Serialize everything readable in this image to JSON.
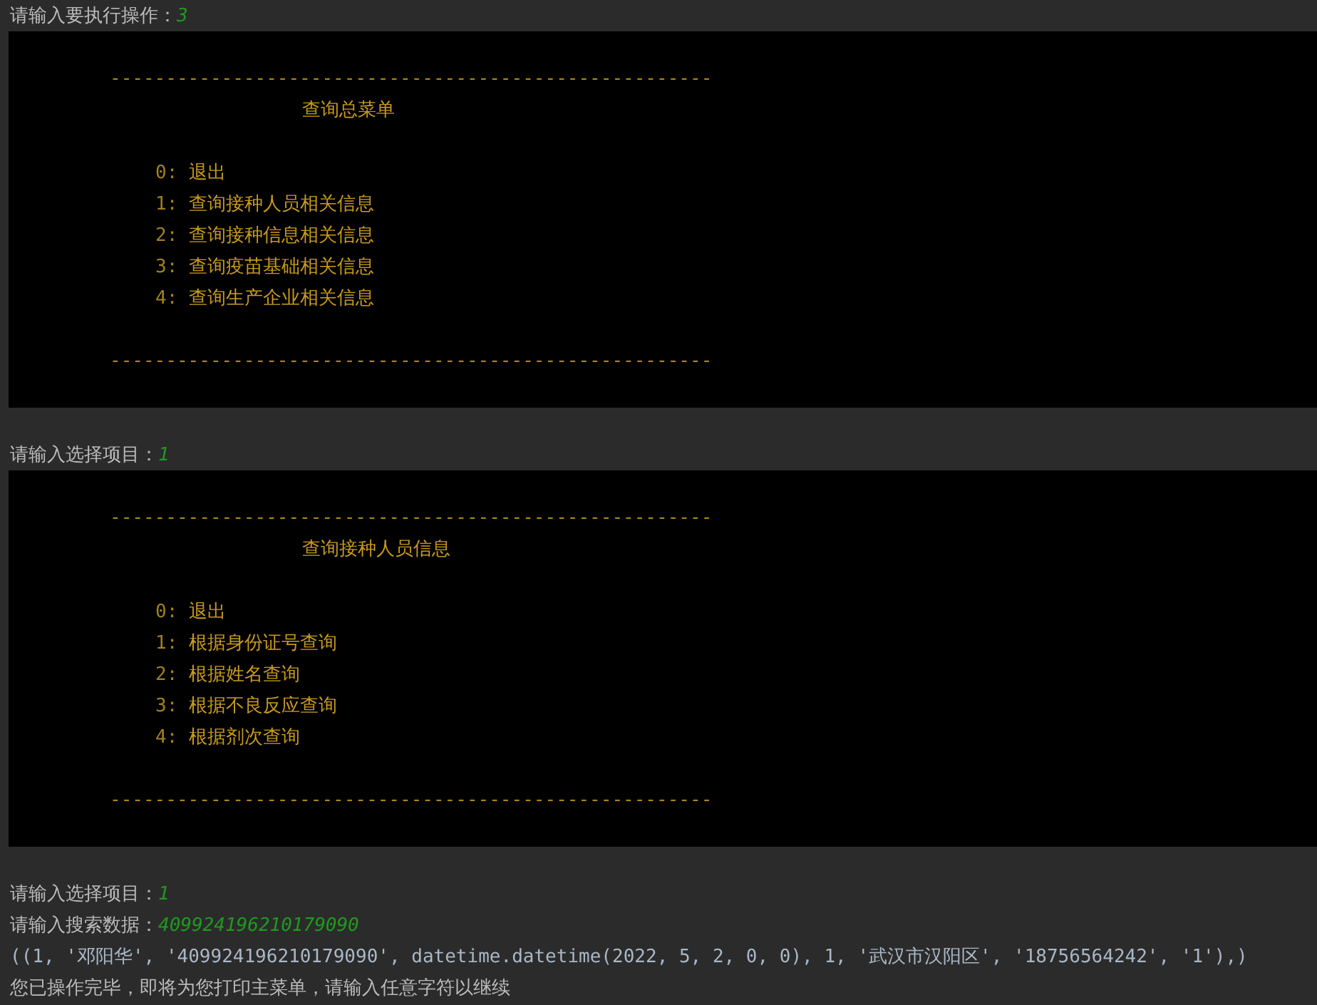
{
  "console": [
    {
      "kind": "prompt",
      "label": "请输入要执行操作：",
      "value": "3"
    },
    {
      "kind": "menu",
      "rule_top": "------------------------------------------------------",
      "title": "查询总菜单",
      "items": [
        {
          "key": "0:",
          "label": "退出"
        },
        {
          "key": "1:",
          "label": "查询接种人员相关信息"
        },
        {
          "key": "2:",
          "label": "查询接种信息相关信息"
        },
        {
          "key": "3:",
          "label": "查询疫苗基础相关信息"
        },
        {
          "key": "4:",
          "label": "查询生产企业相关信息"
        }
      ],
      "rule_bottom": "------------------------------------------------------"
    },
    {
      "kind": "prompt",
      "label": "请输入选择项目：",
      "value": "1"
    },
    {
      "kind": "menu",
      "rule_top": "------------------------------------------------------",
      "title": "查询接种人员信息",
      "items": [
        {
          "key": "0:",
          "label": "退出"
        },
        {
          "key": "1:",
          "label": "根据身份证号查询"
        },
        {
          "key": "2:",
          "label": "根据姓名查询"
        },
        {
          "key": "3:",
          "label": "根据不良反应查询"
        },
        {
          "key": "4:",
          "label": "根据剂次查询"
        }
      ],
      "rule_bottom": "------------------------------------------------------"
    },
    {
      "kind": "prompt",
      "label": "请输入选择项目：",
      "value": "1"
    },
    {
      "kind": "prompt",
      "label": "请输入搜索数据：",
      "value": "409924196210179090"
    },
    {
      "kind": "output",
      "text": "((1, '邓阳华', '409924196210179090', datetime.datetime(2022, 5, 2, 0, 0), 1, '武汉市汉阳区', '18756564242', '1'),)"
    },
    {
      "kind": "message",
      "text": "您已操作完毕，即将为您打印主菜单，请输入任意字符以继续"
    }
  ]
}
